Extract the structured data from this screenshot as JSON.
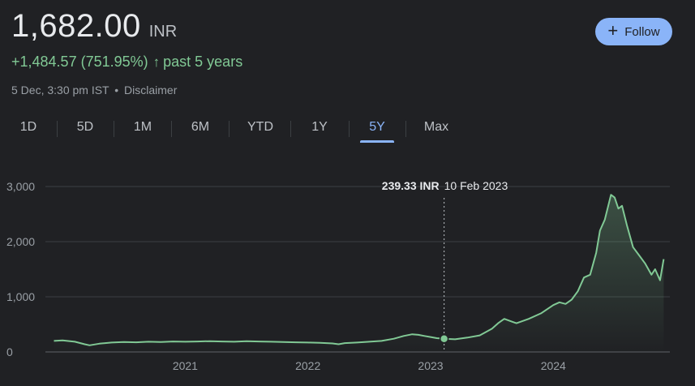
{
  "quote": {
    "price": "1,682.00",
    "currency": "INR",
    "change": "+1,484.57 (751.95%)",
    "change_arrow": "↑",
    "period": "past 5 years",
    "timestamp": "5 Dec, 3:30 pm IST",
    "separator": "•",
    "disclaimer": "Disclaimer"
  },
  "follow": {
    "icon": "plus-icon",
    "label": "Follow"
  },
  "tabs": [
    {
      "label": "1D"
    },
    {
      "label": "5D"
    },
    {
      "label": "1M"
    },
    {
      "label": "6M"
    },
    {
      "label": "YTD"
    },
    {
      "label": "1Y"
    },
    {
      "label": "5Y",
      "active": true
    },
    {
      "label": "Max"
    }
  ],
  "colors": {
    "background": "#202124",
    "line": "#81c995",
    "accent": "#8ab4f8",
    "grid": "#3c4043",
    "text_muted": "#9aa0a6"
  },
  "tooltip": {
    "price": "239.33 INR",
    "date": "10 Feb 2023"
  },
  "chart_data": {
    "type": "line",
    "title": "",
    "xlabel": "",
    "ylabel": "",
    "ylim": [
      0,
      3000
    ],
    "xlim": [
      2019.9,
      2024.95
    ],
    "y_ticks": [
      "0",
      "1,000",
      "2,000",
      "3,000"
    ],
    "x_ticks": [
      {
        "label": "2021",
        "value": 2021.0
      },
      {
        "label": "2022",
        "value": 2022.0
      },
      {
        "label": "2023",
        "value": 2023.0
      },
      {
        "label": "2024",
        "value": 2024.0
      }
    ],
    "grid": true,
    "highlight": {
      "x": 2023.11,
      "y": 239.33
    },
    "series": [
      {
        "x": [
          2019.93,
          2020.0,
          2020.1,
          2020.18,
          2020.22,
          2020.3,
          2020.4,
          2020.5,
          2020.6,
          2020.7,
          2020.8,
          2020.9,
          2021.0,
          2021.1,
          2021.2,
          2021.3,
          2021.4,
          2021.5,
          2021.6,
          2021.7,
          2021.8,
          2021.9,
          2022.0,
          2022.1,
          2022.2,
          2022.25,
          2022.3,
          2022.4,
          2022.5,
          2022.6,
          2022.7,
          2022.78,
          2022.85,
          2022.9,
          2022.95,
          2023.0,
          2023.05,
          2023.11,
          2023.2,
          2023.3,
          2023.4,
          2023.5,
          2023.55,
          2023.6,
          2023.65,
          2023.7,
          2023.8,
          2023.9,
          2024.0,
          2024.05,
          2024.1,
          2024.15,
          2024.2,
          2024.25,
          2024.3,
          2024.35,
          2024.38,
          2024.42,
          2024.47,
          2024.5,
          2024.53,
          2024.56,
          2024.6,
          2024.65,
          2024.7,
          2024.75,
          2024.8,
          2024.83,
          2024.87,
          2024.9
        ],
        "y": [
          200,
          210,
          185,
          140,
          120,
          150,
          170,
          180,
          175,
          185,
          180,
          190,
          185,
          190,
          195,
          190,
          185,
          195,
          190,
          185,
          180,
          175,
          170,
          165,
          155,
          140,
          160,
          170,
          185,
          200,
          240,
          290,
          320,
          310,
          290,
          270,
          250,
          239,
          230,
          260,
          300,
          420,
          520,
          600,
          560,
          520,
          600,
          700,
          850,
          900,
          870,
          950,
          1100,
          1350,
          1400,
          1800,
          2200,
          2400,
          2850,
          2800,
          2600,
          2650,
          2300,
          1900,
          1750,
          1600,
          1400,
          1500,
          1300,
          1682
        ]
      }
    ]
  }
}
